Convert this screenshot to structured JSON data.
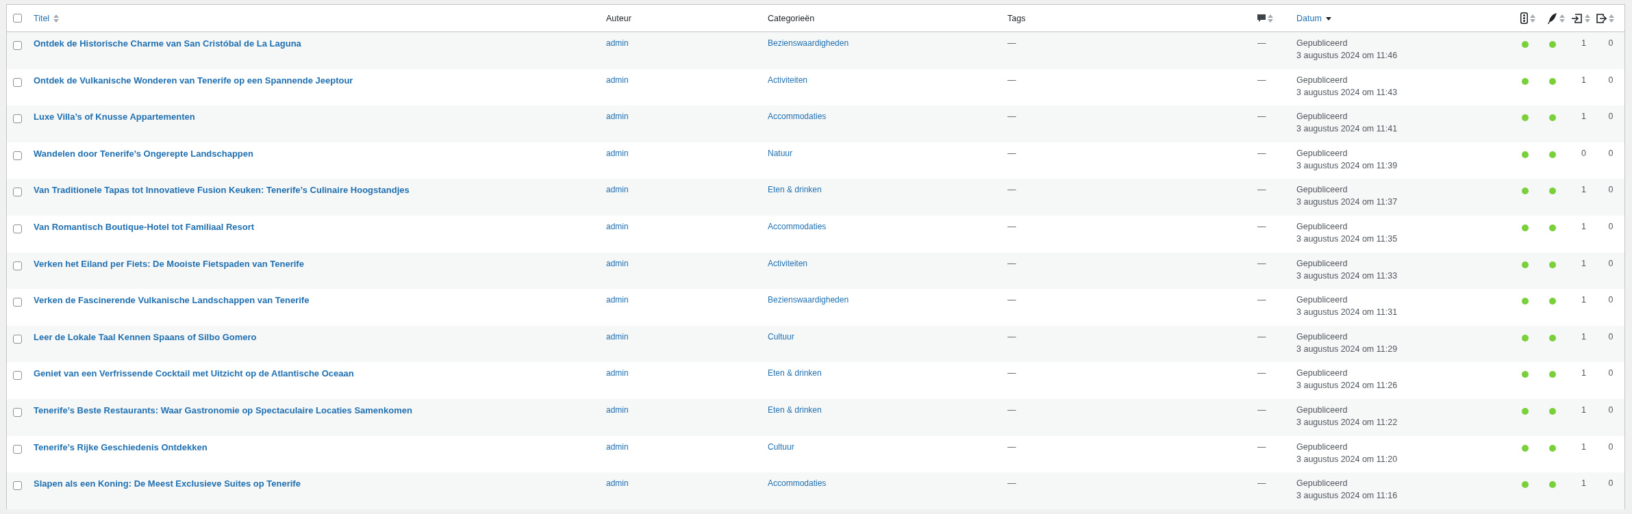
{
  "header": {
    "select_all": {
      "checked": false
    },
    "title": {
      "label": "Titel"
    },
    "author": {
      "label": "Auteur"
    },
    "categories": {
      "label": "Categorieën"
    },
    "tags": {
      "label": "Tags"
    },
    "date": {
      "label": "Datum",
      "sorted": true
    }
  },
  "rows": [
    {
      "checked": false,
      "title": "Ontdek de Historische Charme van San Cristóbal de La Laguna",
      "author": "admin",
      "category": "Bezienswaardigheden",
      "tags": "—",
      "comments": "—",
      "status": "Gepubliceerd",
      "date": "3 augustus 2024 om 11:46",
      "seo": {
        "color": "#7ad03a"
      },
      "readability": {
        "color": "#7ad03a"
      },
      "links_in": "1",
      "links_out": "0"
    },
    {
      "checked": false,
      "title": "Ontdek de Vulkanische Wonderen van Tenerife op een Spannende Jeeptour",
      "author": "admin",
      "category": "Activiteiten",
      "tags": "—",
      "comments": "—",
      "status": "Gepubliceerd",
      "date": "3 augustus 2024 om 11:43",
      "seo": {
        "color": "#7ad03a"
      },
      "readability": {
        "color": "#7ad03a"
      },
      "links_in": "1",
      "links_out": "0"
    },
    {
      "checked": false,
      "title": "Luxe Villa’s of Knusse Appartementen",
      "author": "admin",
      "category": "Accommodaties",
      "tags": "—",
      "comments": "—",
      "status": "Gepubliceerd",
      "date": "3 augustus 2024 om 11:41",
      "seo": {
        "color": "#7ad03a"
      },
      "readability": {
        "color": "#7ad03a"
      },
      "links_in": "1",
      "links_out": "0"
    },
    {
      "checked": false,
      "title": "Wandelen door Tenerife’s Ongerepte Landschappen",
      "author": "admin",
      "category": "Natuur",
      "tags": "—",
      "comments": "—",
      "status": "Gepubliceerd",
      "date": "3 augustus 2024 om 11:39",
      "seo": {
        "color": "#7ad03a"
      },
      "readability": {
        "color": "#7ad03a"
      },
      "links_in": "0",
      "links_out": "0"
    },
    {
      "checked": false,
      "title": "Van Traditionele Tapas tot Innovatieve Fusion Keuken: Tenerife’s Culinaire Hoogstandjes",
      "author": "admin",
      "category": "Eten & drinken",
      "tags": "—",
      "comments": "—",
      "status": "Gepubliceerd",
      "date": "3 augustus 2024 om 11:37",
      "seo": {
        "color": "#7ad03a"
      },
      "readability": {
        "color": "#7ad03a"
      },
      "links_in": "1",
      "links_out": "0"
    },
    {
      "checked": false,
      "title": "Van Romantisch Boutique-Hotel tot Familiaal Resort",
      "author": "admin",
      "category": "Accommodaties",
      "tags": "—",
      "comments": "—",
      "status": "Gepubliceerd",
      "date": "3 augustus 2024 om 11:35",
      "seo": {
        "color": "#7ad03a"
      },
      "readability": {
        "color": "#7ad03a"
      },
      "links_in": "1",
      "links_out": "0"
    },
    {
      "checked": false,
      "title": "Verken het Eiland per Fiets: De Mooiste Fietspaden van Tenerife",
      "author": "admin",
      "category": "Activiteiten",
      "tags": "—",
      "comments": "—",
      "status": "Gepubliceerd",
      "date": "3 augustus 2024 om 11:33",
      "seo": {
        "color": "#7ad03a"
      },
      "readability": {
        "color": "#7ad03a"
      },
      "links_in": "1",
      "links_out": "0"
    },
    {
      "checked": false,
      "title": "Verken de Fascinerende Vulkanische Landschappen van Tenerife",
      "author": "admin",
      "category": "Bezienswaardigheden",
      "tags": "—",
      "comments": "—",
      "status": "Gepubliceerd",
      "date": "3 augustus 2024 om 11:31",
      "seo": {
        "color": "#7ad03a"
      },
      "readability": {
        "color": "#7ad03a"
      },
      "links_in": "1",
      "links_out": "0"
    },
    {
      "checked": false,
      "title": "Leer de Lokale Taal Kennen Spaans of Silbo Gomero",
      "author": "admin",
      "category": "Cultuur",
      "tags": "—",
      "comments": "—",
      "status": "Gepubliceerd",
      "date": "3 augustus 2024 om 11:29",
      "seo": {
        "color": "#7ad03a"
      },
      "readability": {
        "color": "#7ad03a"
      },
      "links_in": "1",
      "links_out": "0"
    },
    {
      "checked": false,
      "title": "Geniet van een Verfrissende Cocktail met Uitzicht op de Atlantische Oceaan",
      "author": "admin",
      "category": "Eten & drinken",
      "tags": "—",
      "comments": "—",
      "status": "Gepubliceerd",
      "date": "3 augustus 2024 om 11:26",
      "seo": {
        "color": "#7ad03a"
      },
      "readability": {
        "color": "#7ad03a"
      },
      "links_in": "1",
      "links_out": "0"
    },
    {
      "checked": false,
      "title": "Tenerife’s Beste Restaurants: Waar Gastronomie op Spectaculaire Locaties Samenkomen",
      "author": "admin",
      "category": "Eten & drinken",
      "tags": "—",
      "comments": "—",
      "status": "Gepubliceerd",
      "date": "3 augustus 2024 om 11:22",
      "seo": {
        "color": "#7ad03a"
      },
      "readability": {
        "color": "#7ad03a"
      },
      "links_in": "1",
      "links_out": "0"
    },
    {
      "checked": false,
      "title": "Tenerife’s Rijke Geschiedenis Ontdekken",
      "author": "admin",
      "category": "Cultuur",
      "tags": "—",
      "comments": "—",
      "status": "Gepubliceerd",
      "date": "3 augustus 2024 om 11:20",
      "seo": {
        "color": "#7ad03a"
      },
      "readability": {
        "color": "#7ad03a"
      },
      "links_in": "1",
      "links_out": "0"
    },
    {
      "checked": false,
      "title": "Slapen als een Koning: De Meest Exclusieve Suites op Tenerife",
      "author": "admin",
      "category": "Accommodaties",
      "tags": "—",
      "comments": "—",
      "status": "Gepubliceerd",
      "date": "3 augustus 2024 om 11:16",
      "seo": {
        "color": "#7ad03a"
      },
      "readability": {
        "color": "#7ad03a"
      },
      "links_in": "1",
      "links_out": "0"
    }
  ]
}
